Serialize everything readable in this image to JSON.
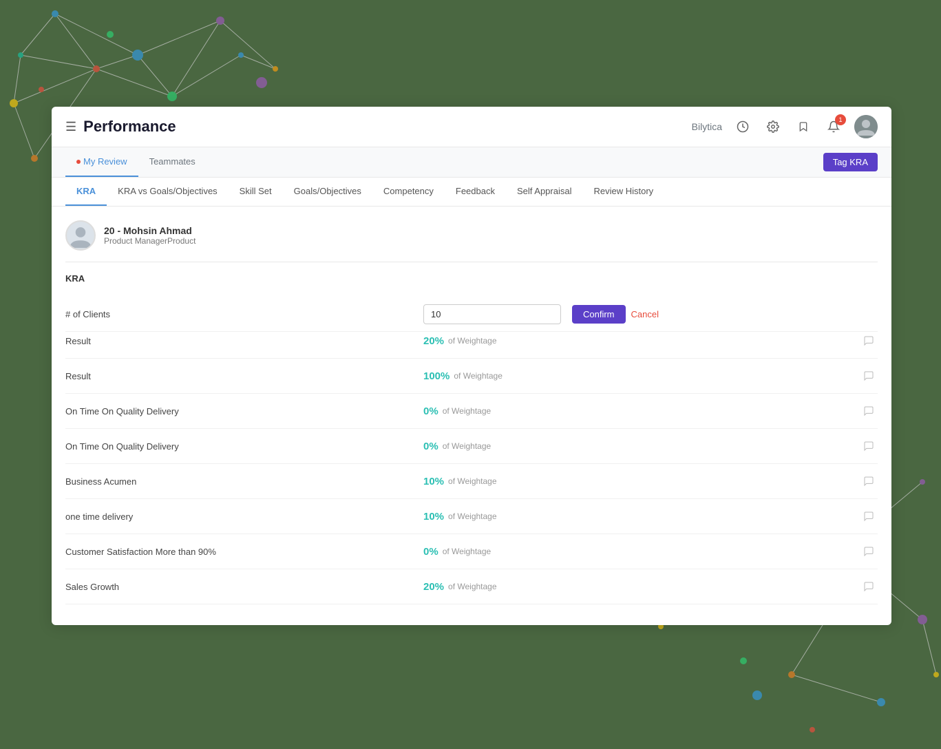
{
  "app": {
    "title": "Performance",
    "brand": "Bilytica",
    "notification_count": "1"
  },
  "sub_header": {
    "tabs": [
      {
        "id": "my-review",
        "label": "My Review",
        "active": true,
        "has_dot": true
      },
      {
        "id": "teammates",
        "label": "Teammates",
        "active": false,
        "has_dot": false
      }
    ],
    "tag_kra_label": "Tag KRA"
  },
  "nav_tabs": [
    {
      "id": "kra",
      "label": "KRA",
      "active": true
    },
    {
      "id": "kra-vs-goals",
      "label": "KRA vs Goals/Objectives",
      "active": false
    },
    {
      "id": "skill-set",
      "label": "Skill Set",
      "active": false
    },
    {
      "id": "goals-objectives",
      "label": "Goals/Objectives",
      "active": false
    },
    {
      "id": "competency",
      "label": "Competency",
      "active": false
    },
    {
      "id": "feedback",
      "label": "Feedback",
      "active": false
    },
    {
      "id": "self-appraisal",
      "label": "Self Appraisal",
      "active": false
    },
    {
      "id": "review-history",
      "label": "Review History",
      "active": false
    }
  ],
  "user": {
    "id": "20",
    "name": "20 - Mohsin Ahmad",
    "role": "Product ManagerProduct"
  },
  "section_title": "KRA",
  "client_input": {
    "label": "# of Clients",
    "value": "10",
    "confirm_label": "Confirm",
    "cancel_label": "Cancel"
  },
  "kra_rows": [
    {
      "label": "Result",
      "percent": "20%",
      "weightage": "of Weightage"
    },
    {
      "label": "Result",
      "percent": "100%",
      "weightage": "of Weightage"
    },
    {
      "label": "On Time On Quality Delivery",
      "percent": "0%",
      "weightage": "of Weightage"
    },
    {
      "label": "On Time On Quality Delivery",
      "percent": "0%",
      "weightage": "of Weightage"
    },
    {
      "label": "Business Acumen",
      "percent": "10%",
      "weightage": "of Weightage"
    },
    {
      "label": "one time delivery",
      "percent": "10%",
      "weightage": "of Weightage"
    },
    {
      "label": "Customer Satisfaction More than 90%",
      "percent": "0%",
      "weightage": "of Weightage"
    },
    {
      "label": "Sales Growth",
      "percent": "20%",
      "weightage": "of Weightage"
    }
  ]
}
